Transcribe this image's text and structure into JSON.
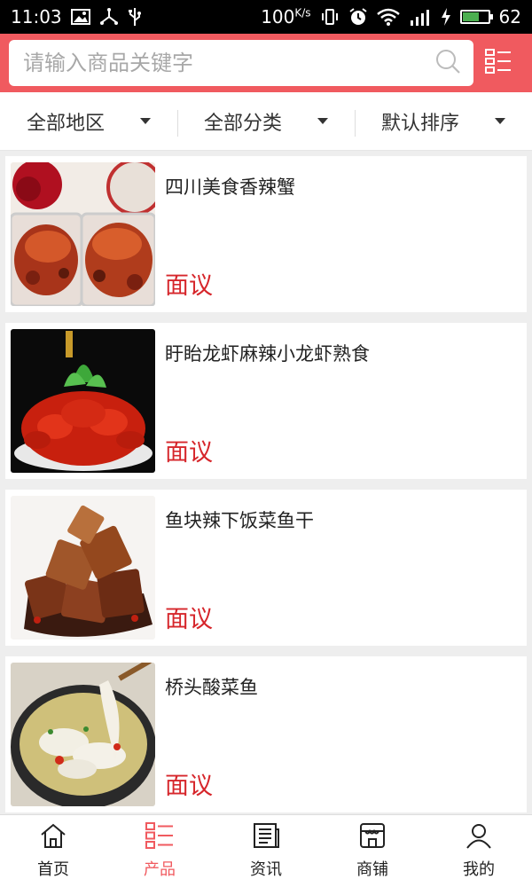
{
  "status_bar": {
    "time": "11:03",
    "net_speed": "100",
    "net_unit": "K/s",
    "battery": "62",
    "battery_fraction": 0.62
  },
  "search": {
    "placeholder": "请输入商品关键字"
  },
  "filters": [
    {
      "label": "全部地区"
    },
    {
      "label": "全部分类"
    },
    {
      "label": "默认排序"
    }
  ],
  "products": [
    {
      "title": "四川美食香辣蟹",
      "price": "面议",
      "image": "spicy-crab-photo"
    },
    {
      "title": "盱眙龙虾麻辣小龙虾熟食",
      "price": "面议",
      "image": "crayfish-photo"
    },
    {
      "title": "鱼块辣下饭菜鱼干",
      "price": "面议",
      "image": "fish-chunks-photo"
    },
    {
      "title": "桥头酸菜鱼",
      "price": "面议",
      "image": "pickled-fish-photo"
    }
  ],
  "nav": [
    {
      "label": "首页",
      "icon": "home-icon"
    },
    {
      "label": "产品",
      "icon": "products-icon",
      "active": true
    },
    {
      "label": "资讯",
      "icon": "news-icon"
    },
    {
      "label": "商铺",
      "icon": "shop-icon"
    },
    {
      "label": "我的",
      "icon": "profile-icon"
    }
  ],
  "colors": {
    "brand": "#f05a5f",
    "price": "#d6262b"
  }
}
